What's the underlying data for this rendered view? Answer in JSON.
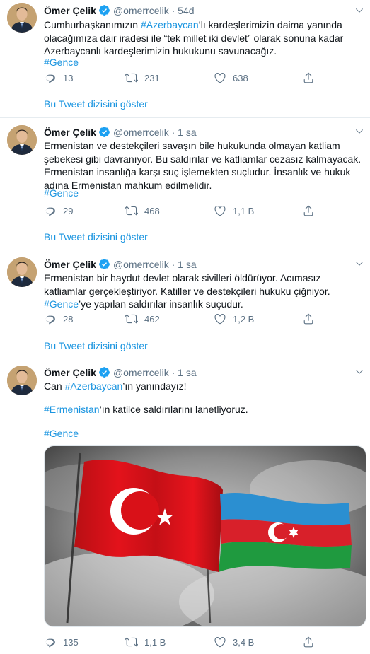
{
  "tweets": [
    {
      "name": "Ömer Çelik",
      "handle": "@omerrcelik",
      "dot": "·",
      "time": "54d",
      "text_parts": [
        "Cumhurbaşkanımızın ",
        "#Azerbaycan",
        "’lı kardeşlerimizin daima yanında olacağımıza dair iradesi ile “tek millet iki devlet” olarak sonuna kadar Azerbaycanlı kardeşlerimizin hukukunu savunacağız."
      ],
      "hashtag_line": "#Gence",
      "replies": "13",
      "retweets": "231",
      "likes": "638",
      "show_thread": "Bu Tweet dizisini göster"
    },
    {
      "name": "Ömer Çelik",
      "handle": "@omerrcelik",
      "dot": "·",
      "time": "1 sa",
      "text": "Ermenistan ve destekçileri savaşın bile hukukunda olmayan katliam şebekesi gibi davranıyor. Bu saldırılar ve katliamlar cezasız kalmayacak. Ermenistan insanlığa karşı suç işlemekten suçludur. İnsanlık ve hukuk adına Ermenistan mahkum edilmelidir.",
      "hashtag_line": "#Gence",
      "replies": "29",
      "retweets": "468",
      "likes": "1,1 B",
      "show_thread": "Bu Tweet dizisini göster"
    },
    {
      "name": "Ömer Çelik",
      "handle": "@omerrcelik",
      "dot": "·",
      "time": "1 sa",
      "text_parts": [
        "Ermenistan bir haydut devlet olarak sivilleri öldürüyor. Acımasız katliamlar gerçekleştiriyor. Katiller ve destekçileri hukuku çiğniyor. ",
        "#Gence",
        "’ye yapılan saldırılar insanlık suçudur."
      ],
      "replies": "28",
      "retweets": "462",
      "likes": "1,2 B",
      "show_thread": "Bu Tweet dizisini göster"
    },
    {
      "name": "Ömer Çelik",
      "handle": "@omerrcelik",
      "dot": "·",
      "time": "1 sa",
      "line1_parts": [
        "Can ",
        "#Azerbaycan",
        "’ın yanındayız!"
      ],
      "line2_parts": [
        "#Ermenistan",
        "’ın katilce saldırılarını lanetliyoruz."
      ],
      "hashtag_line": "#Gence",
      "replies": "135",
      "retweets": "1,1 B",
      "likes": "3,4 B"
    }
  ],
  "colors": {
    "link": "#1b95e0",
    "meta": "#5b7083",
    "verified": "#1da1f2",
    "divider": "#e6ecf0"
  },
  "icons": [
    "reply-icon",
    "retweet-icon",
    "like-icon",
    "share-icon",
    "verified-badge-icon",
    "caret-down-icon"
  ]
}
